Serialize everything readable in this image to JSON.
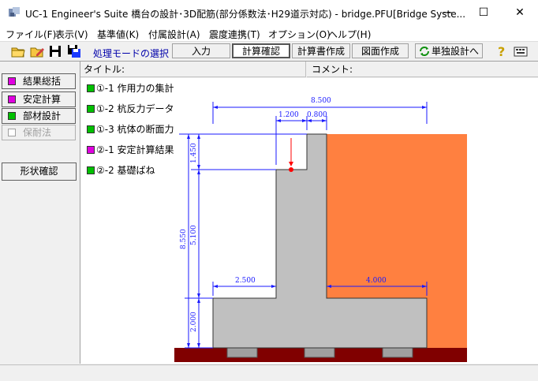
{
  "window": {
    "title": "UC-1 Engineer's Suite 橋台の設計･3D配筋(部分係数法･H29道示対応) - bridge.PFU[Bridge Syste...",
    "minimize": "—",
    "maximize": "☐",
    "close": "✕"
  },
  "menu": [
    "ファイル(F)",
    "表示(V)",
    "基準値(K)",
    "付属設計(A)",
    "震度連携(T)",
    "オプション(O)",
    "ヘルプ(H)"
  ],
  "toolbar": {
    "mode_label": "処理モードの選択",
    "buttons": [
      "入力",
      "計算確認",
      "計算書作成",
      "図面作成",
      "単独設計へ"
    ],
    "active": "計算確認"
  },
  "header": {
    "title_label": "タイトル:",
    "comment_label": "コメント:"
  },
  "left_panel": {
    "buttons": [
      {
        "label": "結果総括",
        "color": "#e000e0"
      },
      {
        "label": "安定計算",
        "color": "#e000e0"
      },
      {
        "label": "部材設計",
        "color": "#00c000"
      },
      {
        "label": "保耐法",
        "color": "#ffffff"
      }
    ],
    "shape_button": "形状確認"
  },
  "items": [
    {
      "label": "①-1 作用力の集計",
      "color": "#00c000"
    },
    {
      "label": "①-2 杭反力データ",
      "color": "#00c000"
    },
    {
      "label": "①-3 杭体の断面力",
      "color": "#00c000"
    },
    {
      "label": "②-1 安定計算結果",
      "color": "#e000e0"
    },
    {
      "label": "②-2 基礎ばね",
      "color": "#00c000"
    }
  ],
  "drawing": {
    "dims": {
      "total_width": "8.500",
      "top_a": "1.200",
      "top_b": "0.800",
      "h_1450": "1.450",
      "h_8550": "8.550",
      "h_5100": "5.100",
      "h_2000": "2.000",
      "left_toe": "2.500",
      "right_heel": "4.000"
    },
    "colors": {
      "concrete": "#c0c0c0",
      "backfill": "#ff8040",
      "ground": "#800000",
      "dim_line": "#1a1aff",
      "load_arrow": "#ff0000"
    }
  }
}
